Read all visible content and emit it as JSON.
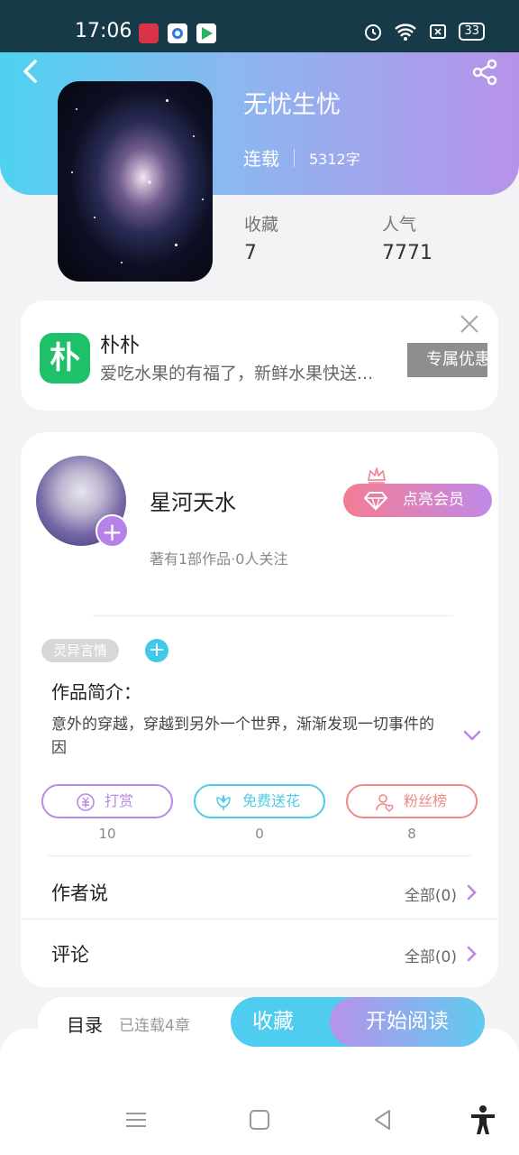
{
  "status_bar": {
    "time": "17:06",
    "battery": "33"
  },
  "book": {
    "title": "无忧生忧",
    "status": "连载",
    "word_count": "5312字",
    "stats": [
      {
        "label": "收藏",
        "value": "7"
      },
      {
        "label": "人气",
        "value": "7771"
      }
    ]
  },
  "ad": {
    "logo_char": "朴",
    "title": "朴朴",
    "description": "爱吃水果的有福了，新鲜水果快送...",
    "button": "专属优惠"
  },
  "author": {
    "name": "星河天水",
    "subtitle": "著有1部作品·0人关注",
    "vip_button": "点亮会员",
    "avatar_plus": "+"
  },
  "genre": {
    "tag": "灵异言情",
    "add": "+"
  },
  "intro": {
    "title": "作品简介：",
    "text": "意外的穿越，穿越到另外一个世界，渐渐发现一切事件的因"
  },
  "actions": [
    {
      "label": "打赏",
      "count": "10",
      "color": "#b98ae6"
    },
    {
      "label": "免费送花",
      "count": "0",
      "color": "#4fcbe7"
    },
    {
      "label": "粉丝榜",
      "count": "8",
      "color": "#ec8a86"
    }
  ],
  "rows": [
    {
      "label": "作者说",
      "value": "全部(0)"
    },
    {
      "label": "评论",
      "value": "全部(0)"
    }
  ],
  "bottom_bar": {
    "catalog": "目录",
    "chapters": "已连载4章",
    "collect": "收藏",
    "read": "开始阅读"
  },
  "icons": [
    "back-icon",
    "share-icon",
    "close-icon",
    "crown-icon",
    "diamond-icon",
    "chevron-down-icon",
    "coin-icon",
    "flower-icon",
    "user-heart-icon",
    "chevron-right-icon",
    "menu-icon",
    "home-icon",
    "back-nav-icon",
    "accessibility-icon"
  ]
}
